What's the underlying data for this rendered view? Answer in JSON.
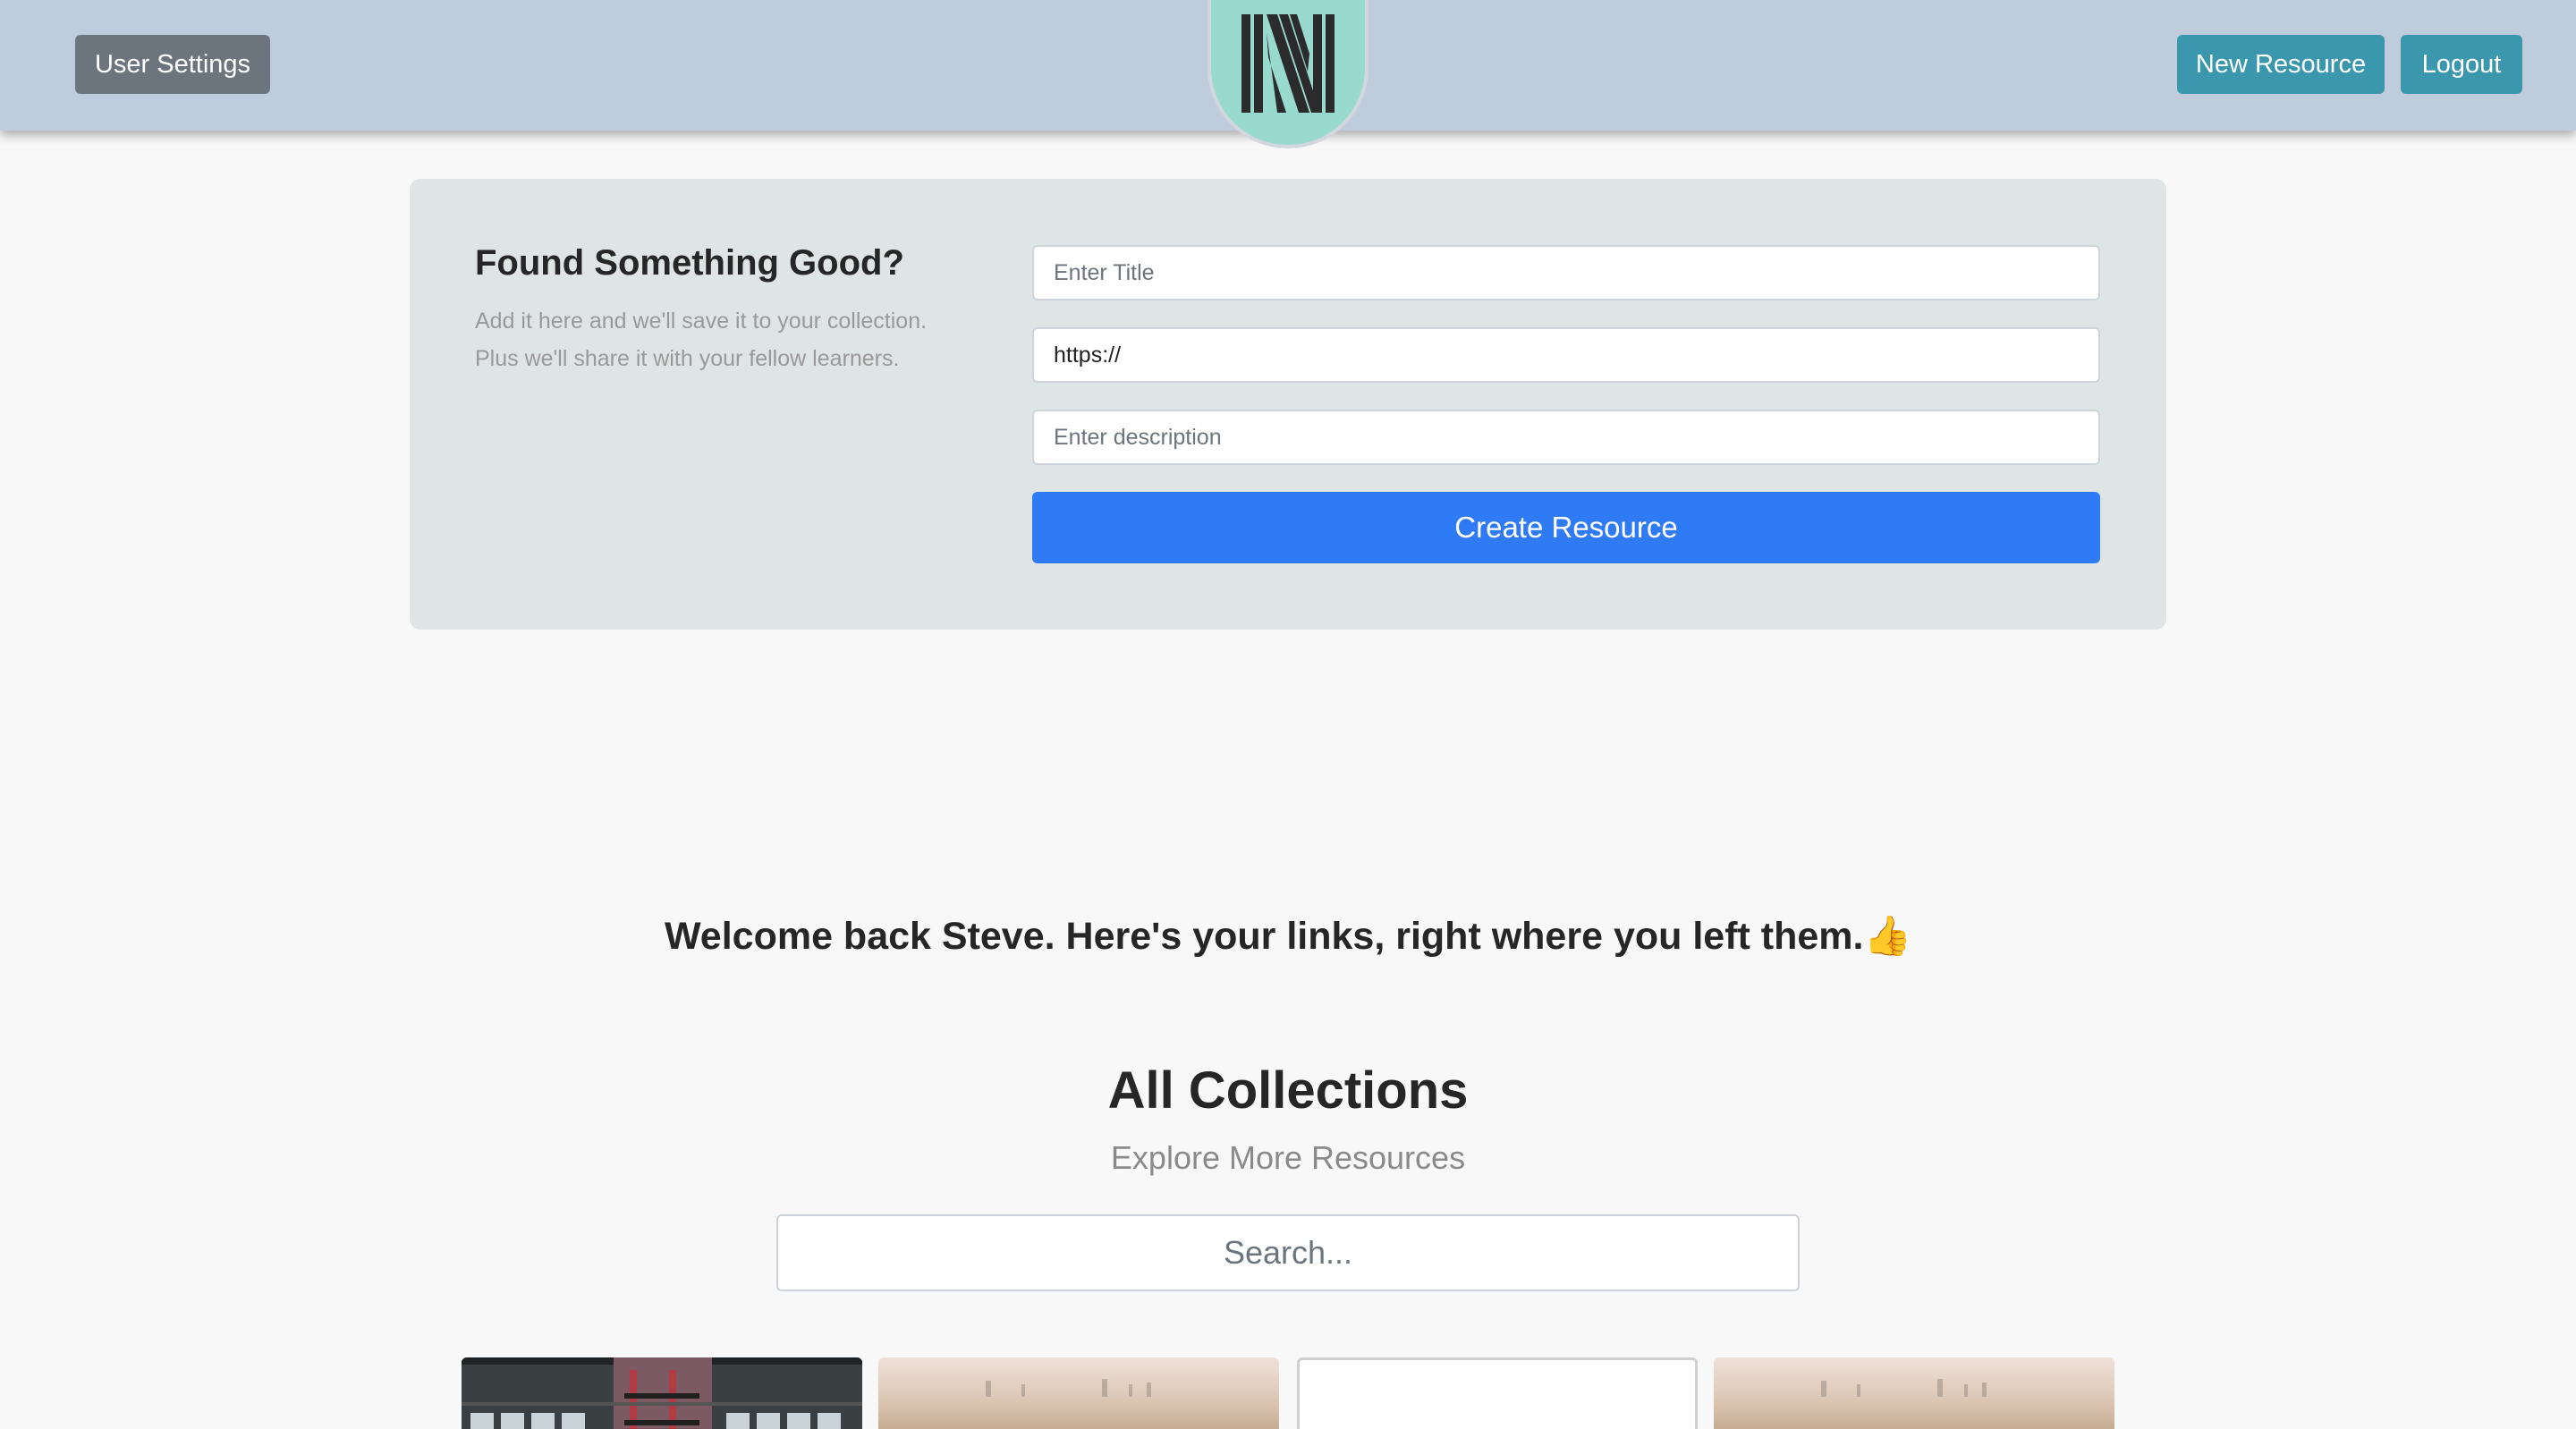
{
  "navbar": {
    "user_settings_label": "User Settings",
    "new_resource_label": "New Resource",
    "logout_label": "Logout",
    "logo_letter": "N"
  },
  "add_resource": {
    "heading": "Found Something Good?",
    "description": "Add it here and we'll save it to your collection. Plus we'll share it with your fellow learners.",
    "title_placeholder": "Enter Title",
    "url_value": "https://",
    "description_placeholder": "Enter description",
    "create_label": "Create Resource"
  },
  "welcome": {
    "message": "Welcome back Steve. Here's your links, right where you left them.👍"
  },
  "collections": {
    "title": "All Collections",
    "subtitle": "Explore More Resources",
    "search_placeholder": "Search..."
  },
  "colors": {
    "navbar": "#bfccdc",
    "accent_teal": "#3a97ad",
    "primary_blue": "#2f7bf5",
    "logo_mint": "#98dace"
  }
}
